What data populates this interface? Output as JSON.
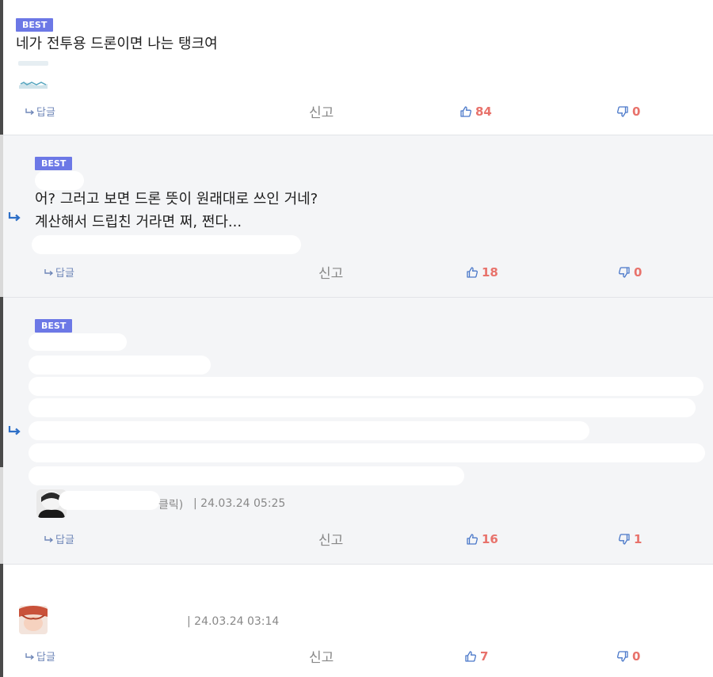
{
  "badge": "BEST",
  "reply_label": "답글",
  "report_label": "신고",
  "comments": [
    {
      "text": "네가 전투용 드론이면 나는 탱크여",
      "likes": "84",
      "dislikes": "0"
    },
    {
      "lines": [
        "어? 그러고 보면 드론 뜻이 원래대로 쓰인 거네?",
        "계산해서 드립친 거라면 쩌, 쩐다..."
      ],
      "likes": "18",
      "dislikes": "0"
    },
    {
      "meta_fragment": "클릭)",
      "meta": "| 24.03.24 05:25",
      "likes": "16",
      "dislikes": "1"
    },
    {
      "meta": "| 24.03.24 03:14",
      "likes": "7",
      "dislikes": "0"
    }
  ],
  "colors": {
    "badge": "#6c78e6",
    "vote": "#e8726b",
    "reply": "#6f87b8",
    "icon_blue": "#4a78c9"
  },
  "icons": {
    "reply_arrow": "reply-arrow-icon",
    "like": "thumbs-up-icon",
    "dislike": "thumbs-down-icon"
  }
}
